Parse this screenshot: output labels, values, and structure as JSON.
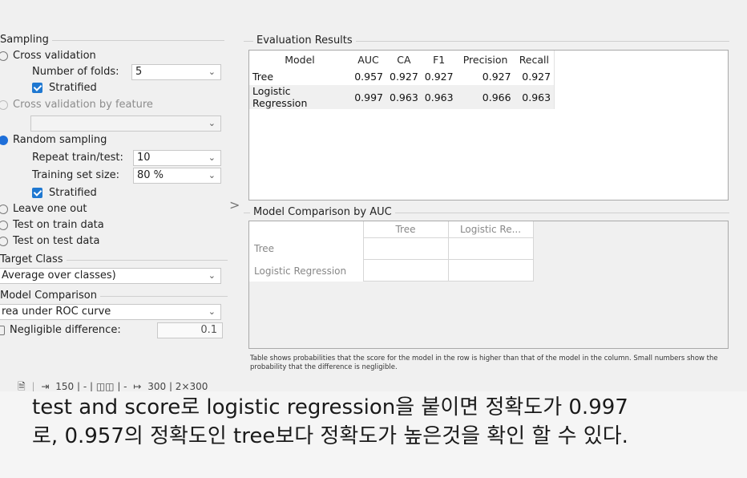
{
  "sampling": {
    "title": "Sampling",
    "cross_validation": "Cross validation",
    "folds_label": "Number of folds:",
    "folds_value": "5",
    "stratified_1": "Stratified",
    "cv_by_feature": "Cross validation by feature",
    "random_sampling": "Random sampling",
    "repeat_label": "Repeat train/test:",
    "repeat_value": "10",
    "train_size_label": "Training set size:",
    "train_size_value": "80 %",
    "stratified_2": "Stratified",
    "leave_one_out": "Leave one out",
    "test_on_train": "Test on train data",
    "test_on_test": "Test on test data"
  },
  "target_class": {
    "title": "Target Class",
    "value": "Average over classes)"
  },
  "model_comparison_settings": {
    "title": "Model Comparison",
    "metric": "rea under ROC curve",
    "negligible_label": "Negligible difference:",
    "negligible_value": "0.1"
  },
  "evaluation": {
    "title": "Evaluation Results",
    "columns": [
      "Model",
      "AUC",
      "CA",
      "F1",
      "Precision",
      "Recall"
    ],
    "rows": [
      [
        "Tree",
        "0.957",
        "0.927",
        "0.927",
        "0.927",
        "0.927"
      ],
      [
        "Logistic Regression",
        "0.997",
        "0.963",
        "0.963",
        "0.966",
        "0.963"
      ]
    ]
  },
  "comparison": {
    "title": "Model Comparison by AUC",
    "columns": [
      "Tree",
      "Logistic Re..."
    ],
    "rows": [
      "Tree",
      "Logistic Regression"
    ],
    "note": "Table shows probabilities that the score for the model in the row is higher than that of the model in the column. Small numbers show the probability that the difference is negligible."
  },
  "status_bar": {
    "input": "150 | - | ◫◫ | -",
    "output": "300 | 2×300"
  },
  "caption": {
    "line1": "test and score로  logistic regression을 붙이면 정확도가 0.997",
    "line2": "로, 0.957의 정확도인 tree보다 정확도가 높은것을 확인 할 수 있다."
  },
  "icons": {
    "toggle": "chevron-right-icon",
    "dropdown": "chevron-down-icon",
    "doc": "document-icon",
    "input": "input-icon",
    "output": "output-icon"
  }
}
